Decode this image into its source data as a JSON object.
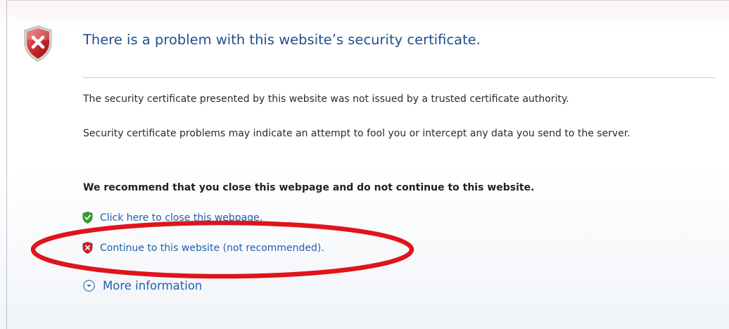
{
  "title": "There is a problem with this website’s security certificate.",
  "paragraphs": {
    "not_trusted": "The security certificate presented by this website was not issued by a trusted certificate authority.",
    "problems": "Security certificate problems may indicate an attempt to fool you or intercept any data you send to the server."
  },
  "recommendation": "We recommend that you close this webpage and do not continue to this website.",
  "links": {
    "close": "Click here to close this webpage.",
    "continue": "Continue to this website (not recommended).",
    "more_info": "More information"
  },
  "icons": {
    "header": "shield-error-icon",
    "close_link": "shield-ok-icon",
    "continue_link": "shield-error-icon",
    "more_info": "chevron-down-circle-icon"
  },
  "colors": {
    "title": "#1f4f8b",
    "link": "#1f5fae",
    "shield_red": "#c8282a",
    "shield_green": "#3a9b2a",
    "highlight_ellipse": "#e0141b"
  }
}
